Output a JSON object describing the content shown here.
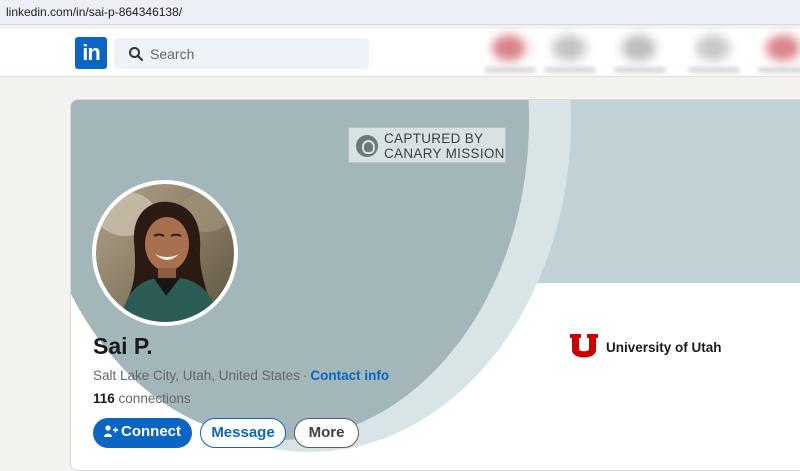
{
  "browser": {
    "url": "linkedin.com/in/sai-p-864346138/"
  },
  "nav": {
    "logo_text": "in",
    "search_placeholder": "Search"
  },
  "banner": {
    "watermark_line1": "CAPTURED BY",
    "watermark_line2": "CANARY MISSION"
  },
  "profile": {
    "name": "Sai P.",
    "location": "Salt Lake City, Utah, United States",
    "separator": "·",
    "contact_info": "Contact info",
    "connections_count": "116",
    "connections_label": "connections",
    "school": "University of Utah"
  },
  "actions": {
    "connect": "Connect",
    "message": "Message",
    "more": "More"
  },
  "colors": {
    "brand_blue": "#0a66c2",
    "utah_red": "#cc0000",
    "banner_dark": "#a3b7bb",
    "banner_light": "#c0d2d6"
  }
}
